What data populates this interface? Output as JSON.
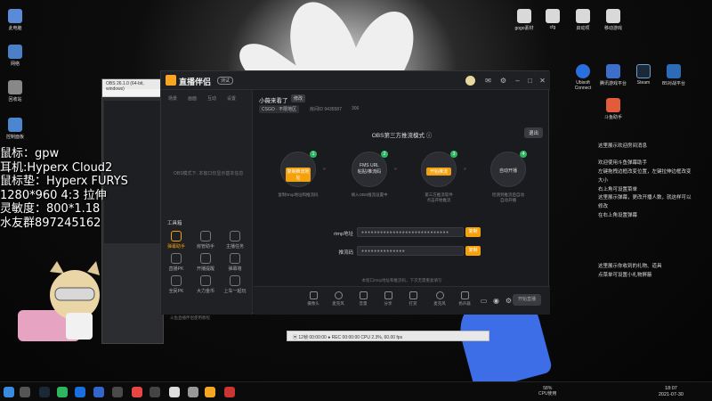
{
  "overlay": {
    "lines": [
      "鼠标：gpw",
      "耳机:Hyperx Cloud2",
      "鼠标垫：Hyperx FURYS",
      "1280*960 4:3 拉伸",
      "灵敏度：800*1.18",
      "水友群897245162"
    ]
  },
  "desktop": {
    "icons": [
      "此电脑",
      "网络",
      "回收站",
      "控制面板",
      "gogo素材",
      "cfg",
      "启动项",
      "移动游戏",
      "Ubisoft Connect",
      "Steam",
      "腾讯游戏平台",
      "斗鱼助手",
      "B5对战平台"
    ]
  },
  "obs": {
    "title": "OBS 26.1.0 (64-bit, windows)",
    "statusbar": "▣ 12帧  00:00:00  ● REC 00:00:00   CPU 2.3%, 60.00 fps"
  },
  "app": {
    "title": "直播伴侣",
    "beta": "测试",
    "left": {
      "tabs": [
        "场景",
        "画面",
        "互动",
        "设置"
      ],
      "hint": "OBS模式下, 本窗口仅显示基本信息",
      "tools_title": "工具箱",
      "tools": [
        "弹幕助手",
        "房管助手",
        "主播任务",
        "直播PK",
        "开播提醒",
        "弹幕墙",
        "全民PK",
        "大力金币",
        "上车一起玩"
      ],
      "status": "斗鱼直播伴侣使用教程"
    },
    "main": {
      "room_title": "小薇来看了",
      "edit": "修改",
      "game": "CSGO · 不限地区",
      "room_info": "房间ID 9435587",
      "fans": "306",
      "mode_title": "OBS第三方推流模式 ⓘ",
      "exit": "退出",
      "steps": [
        {
          "num": "1",
          "label": "复制推流地址",
          "desc": "复制rtmp地址和推流码"
        },
        {
          "num": "2",
          "label": "FMS URL\n粘贴/推流码",
          "desc": "填入OBS推流设置中"
        },
        {
          "num": "3",
          "label": "开始推流",
          "desc": "第三方推流软件\n点击开始推流"
        },
        {
          "num": "4",
          "label": "自动开播",
          "desc": "检测到推流后自动\n自动开播"
        }
      ],
      "rtmp_label": "rtmp地址",
      "rtmp_value": "●●●●●●●●●●●●●●●●●●●●●●●●●●●●",
      "key_label": "推流码",
      "key_value": "●●●●●●●●●●●●●●",
      "copy": "复制",
      "tip": "本窗口rtmp地址和推流码，下次无需重复填写"
    },
    "bottom": {
      "buttons": [
        "摄像头",
        "麦克风",
        "音量",
        "分享",
        "打赏",
        "麦克风",
        "扬声器"
      ],
      "start": "开始直播"
    }
  },
  "right_panel": {
    "lines": [
      "这里展示欢迎房间消息",
      "",
      "欢迎使用斗鱼弹幕助手",
      "左键拖拽边框改变位置，左键拉伸边框改变",
      "大小",
      "右上角可设置菜单",
      "这里展示弹幕，更改开播人数，就这样可以",
      "修改",
      "在右上角设置弹幕",
      "",
      "",
      "",
      "",
      "",
      "这里展示你收到的礼物、道具",
      "点菜单可设置小礼物屏蔽"
    ]
  },
  "taskbar": {
    "cpu": "58%\nCPU使用",
    "time": "18:07",
    "date": "2021-07-30"
  }
}
